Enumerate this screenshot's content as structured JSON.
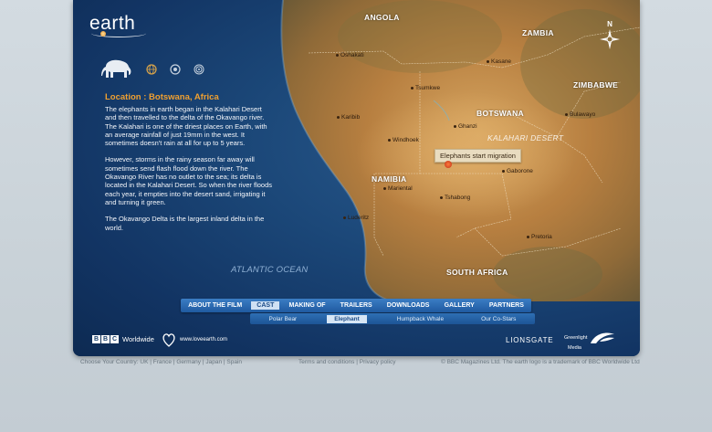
{
  "logo": {
    "text": "earth"
  },
  "location": {
    "title": "Location : Botswana, Africa"
  },
  "description": [
    "The elephants in earth began in the Kalahari Desert and then travelled to the delta of the Okavango river. The Kalahari is one of the driest places on Earth, with an average rainfall of just 19mm in the west. It sometimes doesn't rain at all for up to 5 years.",
    "However, storms in the rainy season far away will sometimes send flash flood down the river. The Okavango River has no outlet to the sea; its delta is located in the Kalahari Desert. So when the river floods each year, it empties into the desert sand, irrigating it and turning it green.",
    "The Okavango Delta is the largest inland delta in the world."
  ],
  "map": {
    "countries": [
      "ANGOLA",
      "ZAMBIA",
      "ZIMBABWE",
      "BOTSWANA",
      "NAMIBIA",
      "SOUTH AFRICA"
    ],
    "cities": [
      "Oshakati",
      "Kasane",
      "Tsumkwe",
      "Bulawayo",
      "Karibib",
      "Ghanzi",
      "Windhoek",
      "Gaborone",
      "Mariental",
      "Tshabong",
      "Luderitz",
      "Pretoria"
    ],
    "region": "KALAHARI DESERT",
    "ocean": "ATLANTIC OCEAN",
    "callout": "Elephants start migration",
    "compass": "N"
  },
  "nav": {
    "items": [
      "ABOUT THE FILM",
      "CAST",
      "MAKING OF",
      "TRAILERS",
      "DOWNLOADS",
      "GALLERY",
      "PARTNERS"
    ],
    "active": "CAST"
  },
  "subnav": {
    "items": [
      "Polar Bear",
      "Elephant",
      "Humpback Whale",
      "Our Co-Stars"
    ],
    "active": "Elephant"
  },
  "brands": {
    "bbc_letters": [
      "B",
      "B",
      "C"
    ],
    "bbc_worldwide": "Worldwide",
    "love_earth": "www.loveearth.com",
    "lionsgate": "LIONSGATE",
    "greenlight_1": "Greenlight",
    "greenlight_2": "Media"
  },
  "footer": {
    "country_label": "Choose Your Country:",
    "countries": [
      "UK",
      "France",
      "Germany",
      "Japan",
      "Spain"
    ],
    "legal": [
      "Terms and conditions",
      "Privacy policy"
    ],
    "copyright": "© BBC Magazines Ltd. The earth logo is a trademark of BBC Worldwide Ltd"
  },
  "colors": {
    "ocean": "#173d6b",
    "land": "#c08a4a",
    "accent": "#f0a030",
    "nav": "#2a6ab0"
  },
  "icons": [
    "elephant-icon",
    "globe-icon",
    "target-icon",
    "ring-icon"
  ]
}
